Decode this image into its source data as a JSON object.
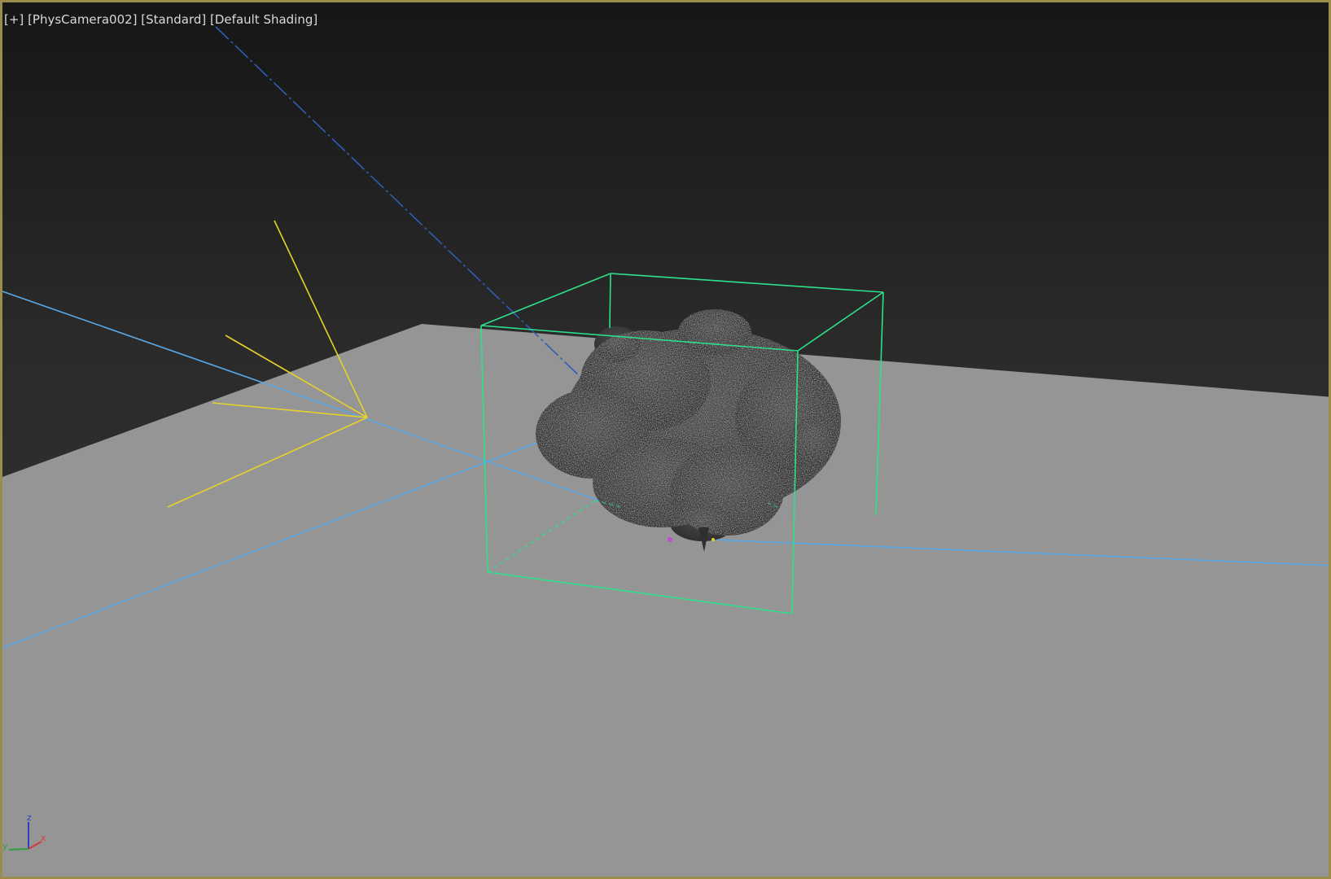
{
  "viewport": {
    "labels": {
      "plus": "[+]",
      "camera": "[PhysCamera002]",
      "mode": "[Standard]",
      "shading": "[Default Shading]"
    },
    "axis_gizmo": {
      "z": "z",
      "x": "x",
      "y": "y"
    }
  },
  "colors": {
    "border": "#9a8d4a",
    "ground": "#959595",
    "bounding_box": "#2ee08a",
    "camera_lines": "#5aa8e6",
    "light_lines": "#e8d22a",
    "target_line": "#2f5db3",
    "tree": "#3f3f3f"
  },
  "icons": [
    "tree-foliage-icon",
    "light-icon",
    "camera-icon",
    "axis-gizmo-icon"
  ]
}
